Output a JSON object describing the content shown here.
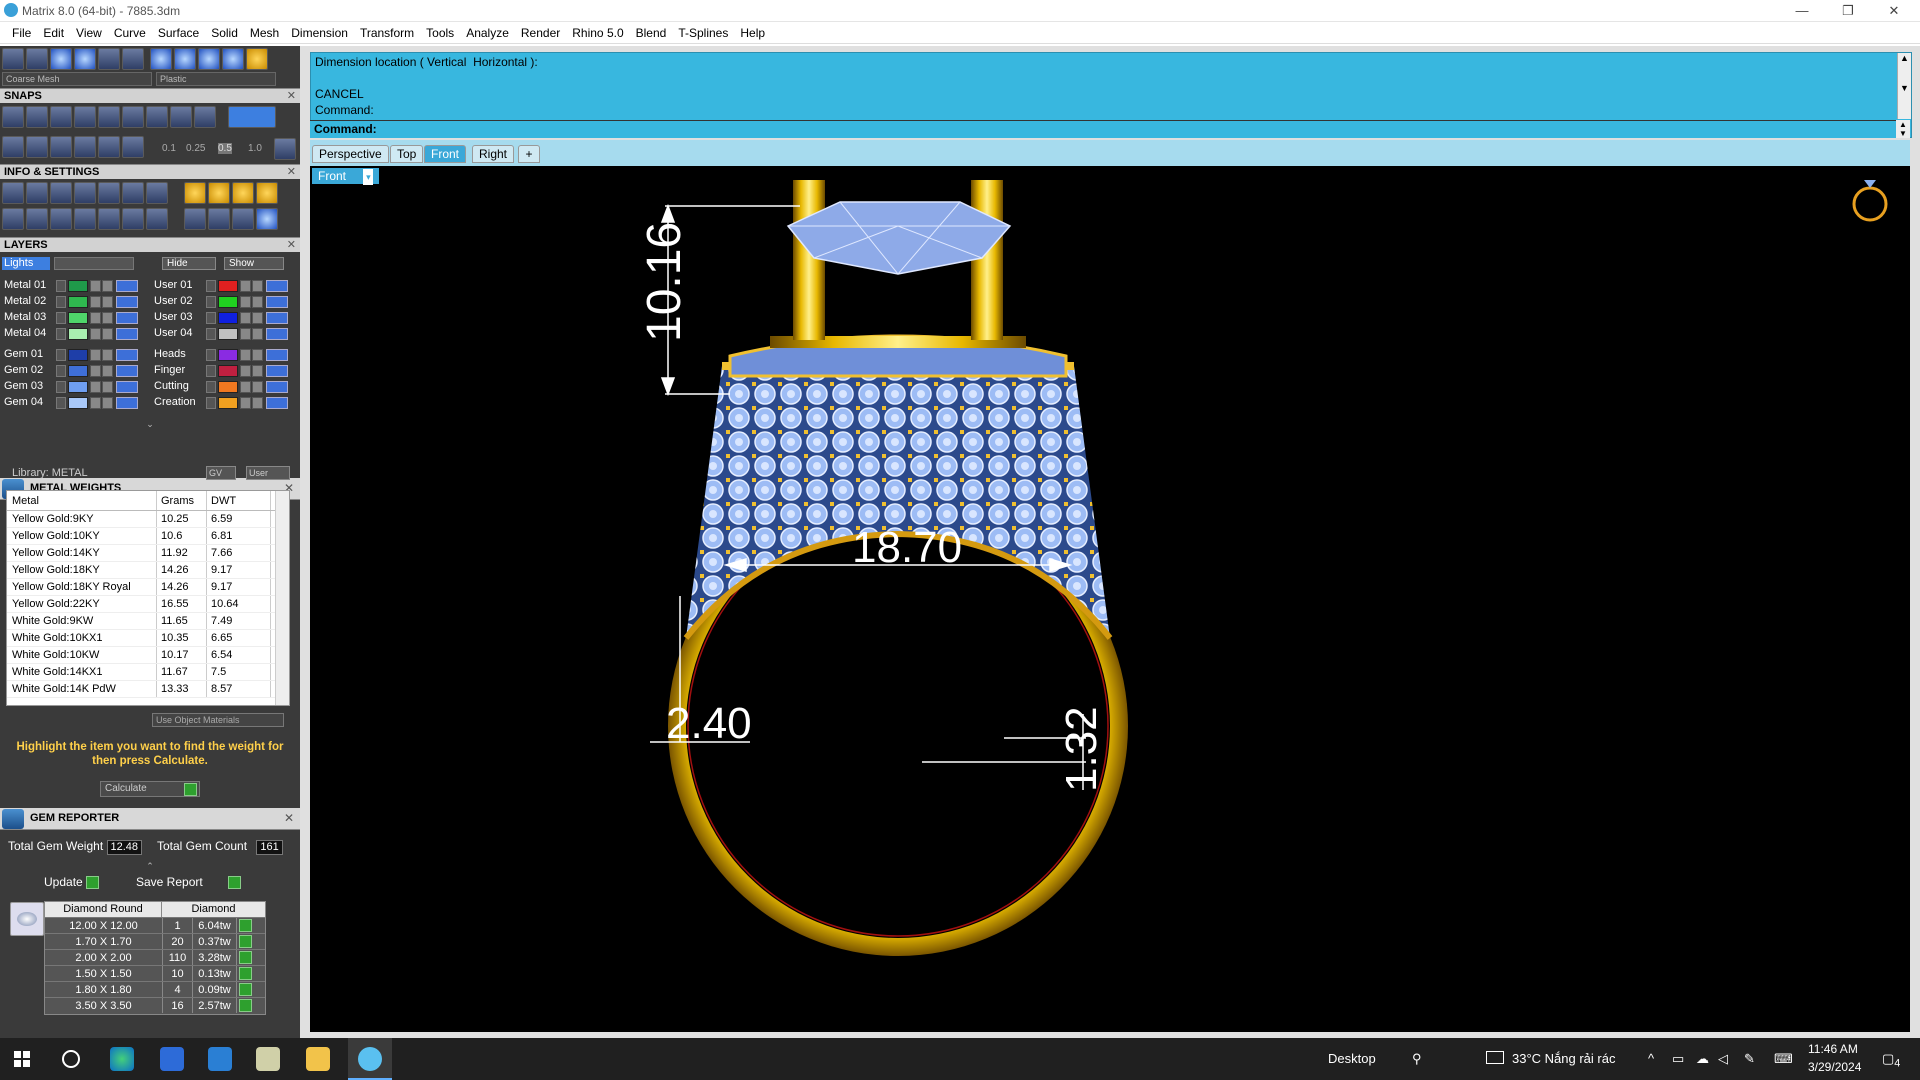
{
  "window": {
    "title": "Matrix 8.0 (64-bit) - 7885.3dm",
    "min": "—",
    "restore": "❐",
    "close": "✕"
  },
  "menu": [
    "File",
    "Edit",
    "View",
    "Curve",
    "Surface",
    "Solid",
    "Mesh",
    "Dimension",
    "Transform",
    "Tools",
    "Analyze",
    "Render",
    "Rhino 5.0",
    "Blend",
    "T-Splines",
    "Help"
  ],
  "toolbar": {
    "mesh_dropdown": "Coarse Mesh",
    "material_dropdown": "Plastic"
  },
  "snaps": {
    "header": "SNAPS",
    "values": [
      "0.1",
      "0.25",
      "0.5",
      "1.0"
    ]
  },
  "info": {
    "header": "INFO & SETTINGS"
  },
  "layers": {
    "header": "LAYERS",
    "lights": "Lights",
    "hide": "Hide",
    "show": "Show",
    "left": [
      {
        "name": "Metal 01",
        "color": "#1f9a4a"
      },
      {
        "name": "Metal 02",
        "color": "#2fb84f"
      },
      {
        "name": "Metal 03",
        "color": "#4fd66a"
      },
      {
        "name": "Metal 04",
        "color": "#a9eeb0"
      },
      {
        "name": "Gem 01",
        "color": "#1e3ea8"
      },
      {
        "name": "Gem 02",
        "color": "#3f6fd8"
      },
      {
        "name": "Gem 03",
        "color": "#6f9ef0"
      },
      {
        "name": "Gem 04",
        "color": "#a9c8f8"
      }
    ],
    "right": [
      {
        "name": "User 01",
        "color": "#e02020"
      },
      {
        "name": "User 02",
        "color": "#20d020"
      },
      {
        "name": "User 03",
        "color": "#1020e0"
      },
      {
        "name": "User 04",
        "color": "#c0c0c0"
      },
      {
        "name": "Heads",
        "color": "#8a2be2"
      },
      {
        "name": "Finger",
        "color": "#c02040"
      },
      {
        "name": "Cutting",
        "color": "#f07820"
      },
      {
        "name": "Creation",
        "color": "#f0a020"
      }
    ]
  },
  "metal_weights": {
    "header": "METAL WEIGHTS",
    "library": "Library: METAL",
    "gv": "GV",
    "user": "User",
    "columns": [
      "Metal",
      "Grams",
      "DWT"
    ],
    "rows": [
      [
        "Yellow Gold:9KY",
        "10.25",
        "6.59"
      ],
      [
        "Yellow Gold:10KY",
        "10.6",
        "6.81"
      ],
      [
        "Yellow Gold:14KY",
        "11.92",
        "7.66"
      ],
      [
        "Yellow Gold:18KY",
        "14.26",
        "9.17"
      ],
      [
        "Yellow Gold:18KY Royal",
        "14.26",
        "9.17"
      ],
      [
        "Yellow Gold:22KY",
        "16.55",
        "10.64"
      ],
      [
        "White Gold:9KW",
        "11.65",
        "7.49"
      ],
      [
        "White Gold:10KX1",
        "10.35",
        "6.65"
      ],
      [
        "White Gold:10KW",
        "10.17",
        "6.54"
      ],
      [
        "White Gold:14KX1",
        "11.67",
        "7.5"
      ],
      [
        "White Gold:14K PdW",
        "13.33",
        "8.57"
      ]
    ],
    "use_object_materials": "Use Object Materials",
    "note": "Highlight the item you want to find the weight for then press Calculate.",
    "calculate": "Calculate"
  },
  "gem_reporter": {
    "header": "GEM REPORTER",
    "total_weight_label": "Total Gem Weight",
    "total_weight": "12.48",
    "total_count_label": "Total Gem Count",
    "total_count": "161",
    "update": "Update",
    "save_report": "Save Report",
    "columns": [
      "Diamond Round",
      "Diamond"
    ],
    "rows": [
      [
        "12.00 X 12.00",
        "1",
        "6.04tw"
      ],
      [
        "1.70 X 1.70",
        "20",
        "0.37tw"
      ],
      [
        "2.00 X 2.00",
        "110",
        "3.28tw"
      ],
      [
        "1.50 X 1.50",
        "10",
        "0.13tw"
      ],
      [
        "1.80 X 1.80",
        "4",
        "0.09tw"
      ],
      [
        "3.50 X 3.50",
        "16",
        "2.57tw"
      ]
    ]
  },
  "command": {
    "line1": "Dimension location ( Vertical  Horizontal ):",
    "line2": "CANCEL",
    "line3": "Command:",
    "prompt": "Command:"
  },
  "viewtabs": [
    "Perspective",
    "Top",
    "Front",
    "Right"
  ],
  "viewport": {
    "label": "Front"
  },
  "dimensions": {
    "height": "10.16",
    "inner": "18.70",
    "shank": "2.40",
    "bottom": "1.32"
  },
  "taskbar": {
    "desktop": "Desktop",
    "weather": "33°C  Nắng rải rác",
    "time": "11:46 AM",
    "date": "3/29/2024",
    "notif": "4"
  },
  "colors": {
    "cmd_bg": "#38b7df",
    "viewport_bg": "#000000",
    "gold": "#e8b800",
    "gem": "#8fb4f0"
  }
}
